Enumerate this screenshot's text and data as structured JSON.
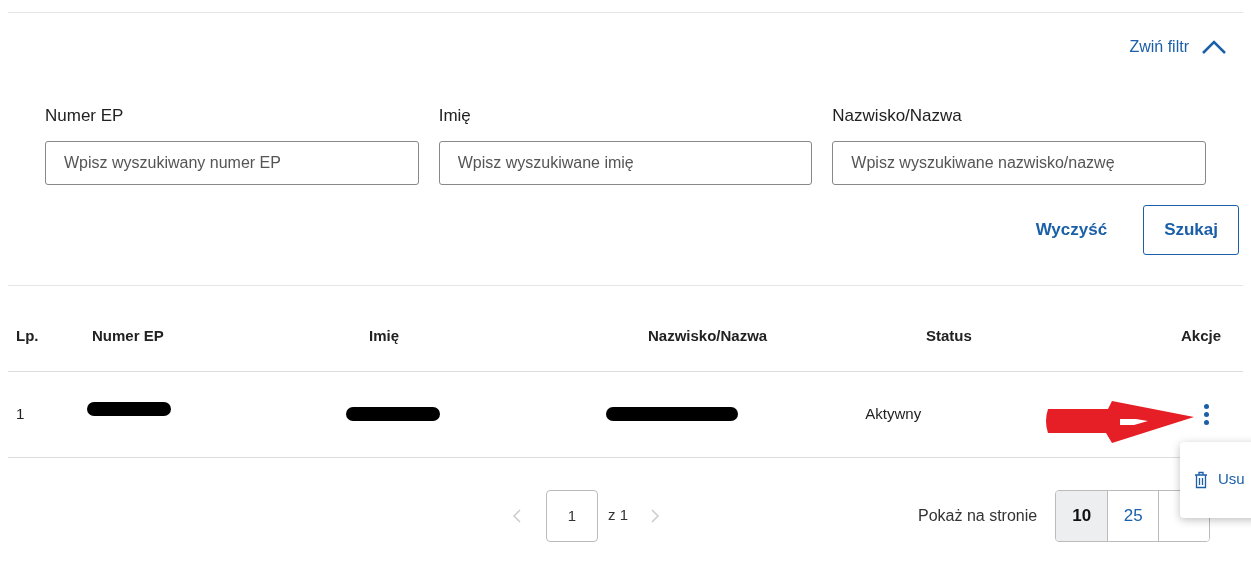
{
  "filter_toggle": {
    "label": "Zwiń filtr",
    "expanded": true
  },
  "fields": [
    {
      "label": "Numer EP",
      "placeholder": "Wpisz wyszukiwany numer EP"
    },
    {
      "label": "Imię",
      "placeholder": "Wpisz wyszukiwane imię"
    },
    {
      "label": "Nazwisko/Nazwa",
      "placeholder": "Wpisz wyszukiwane nazwisko/nazwę"
    }
  ],
  "actions": [
    {
      "label": "Wyczyść",
      "kind": "link"
    },
    {
      "label": "Szukaj",
      "kind": "outlined"
    }
  ],
  "table": {
    "columns": [
      "Lp.",
      "Numer EP",
      "Imię",
      "Nazwisko/Nazwa",
      "Status",
      "Akcje"
    ],
    "rows": [
      {
        "cells": [
          {
            "text": "1"
          },
          {
            "redacted": true
          },
          {
            "redacted": true
          },
          {
            "redacted": true
          },
          {
            "text": "Aktywny"
          }
        ],
        "menu_open": true
      }
    ]
  },
  "row_menu": [
    {
      "label": "Usu"
    }
  ],
  "pagination": {
    "page": "1",
    "of": "z 1"
  },
  "page_size": {
    "label": "Pokaż na stronie",
    "options": [
      {
        "label": "10",
        "selected": true
      },
      {
        "label": "25",
        "selected": false
      }
    ]
  }
}
